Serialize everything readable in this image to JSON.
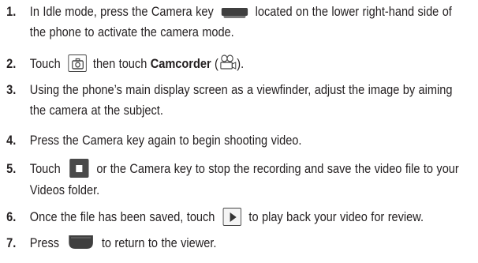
{
  "steps": [
    {
      "num": "1.",
      "before": "In Idle mode, press the Camera key",
      "after": "located on the lower right-hand side of the phone to activate the camera mode.",
      "icon": "camera-key-icon"
    },
    {
      "num": "2.",
      "before": "Touch",
      "middle": "then touch",
      "bold": "Camcorder",
      "paren_open": "(",
      "paren_close": ").",
      "icons": [
        "camera-button-icon",
        "camcorder-icon"
      ]
    },
    {
      "num": "3.",
      "text": "Using the phone’s main display screen as a viewfinder, adjust the image by aiming the camera at the subject."
    },
    {
      "num": "4.",
      "text": "Press the Camera key again to begin shooting video."
    },
    {
      "num": "5.",
      "before": "Touch",
      "after": "or the Camera key to stop the recording and save the video file to your Videos folder.",
      "icon": "stop-button-icon"
    },
    {
      "num": "6.",
      "before": "Once the file has been saved, touch",
      "after": "to play back your video for review.",
      "icon": "play-button-icon"
    },
    {
      "num": "7.",
      "before": "Press",
      "after": "to return to the viewer.",
      "icon": "back-key-icon"
    }
  ],
  "colors": {
    "text": "#231f20",
    "icon_dark": "#3f3f3f"
  }
}
